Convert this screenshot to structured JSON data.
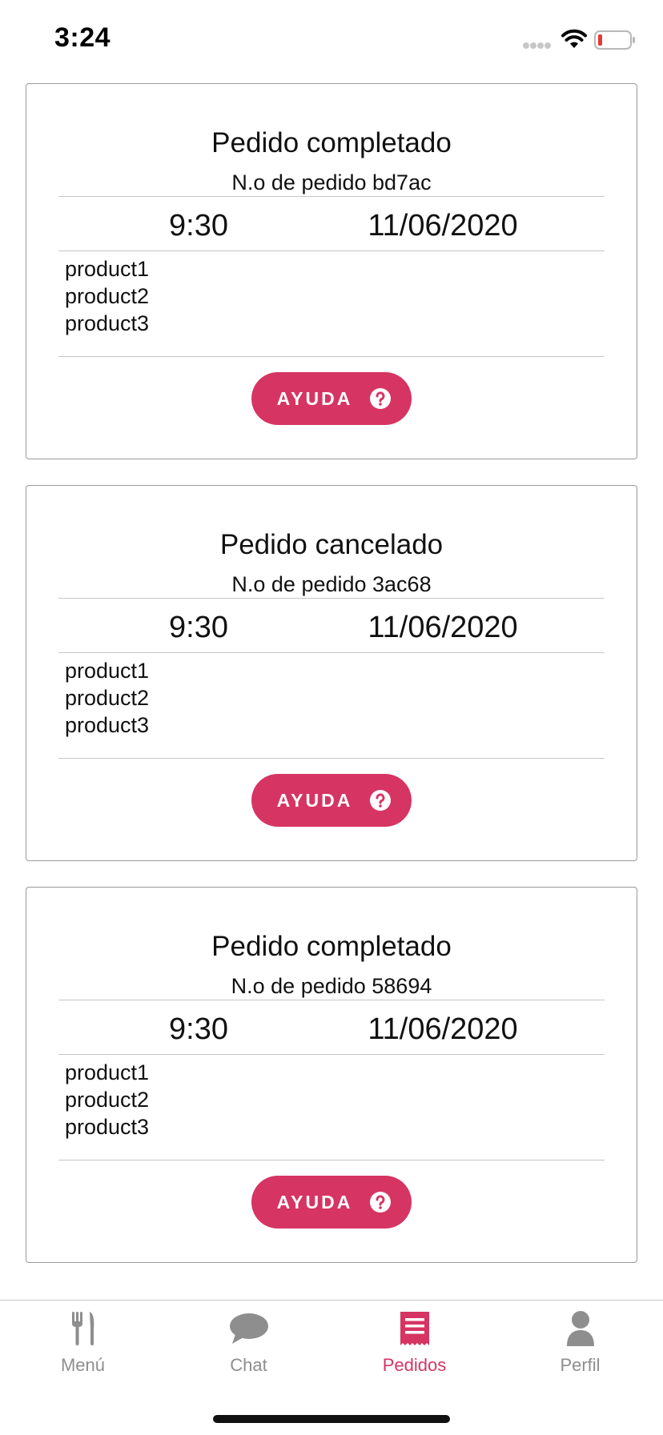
{
  "status_bar": {
    "time": "3:24"
  },
  "colors": {
    "accent": "#d63463",
    "tab_inactive": "#8e8e8e",
    "battery_low": "#e53935"
  },
  "orders": [
    {
      "status": "Pedido completado",
      "number": "N.o de pedido bd7ac",
      "time": "9:30",
      "date": "11/06/2020",
      "products": [
        "product1",
        "product2",
        "product3"
      ],
      "help_label": "AYUDA"
    },
    {
      "status": "Pedido cancelado",
      "number": "N.o de pedido 3ac68",
      "time": "9:30",
      "date": "11/06/2020",
      "products": [
        "product1",
        "product2",
        "product3"
      ],
      "help_label": "AYUDA"
    },
    {
      "status": "Pedido completado",
      "number": "N.o de pedido 58694",
      "time": "9:30",
      "date": "11/06/2020",
      "products": [
        "product1",
        "product2",
        "product3"
      ],
      "help_label": "AYUDA"
    }
  ],
  "tabs": [
    {
      "label": "Menú",
      "icon": "fork-knife-icon",
      "active": false
    },
    {
      "label": "Chat",
      "icon": "chat-bubble-icon",
      "active": false
    },
    {
      "label": "Pedidos",
      "icon": "receipt-icon",
      "active": true
    },
    {
      "label": "Perfil",
      "icon": "person-icon",
      "active": false
    }
  ]
}
